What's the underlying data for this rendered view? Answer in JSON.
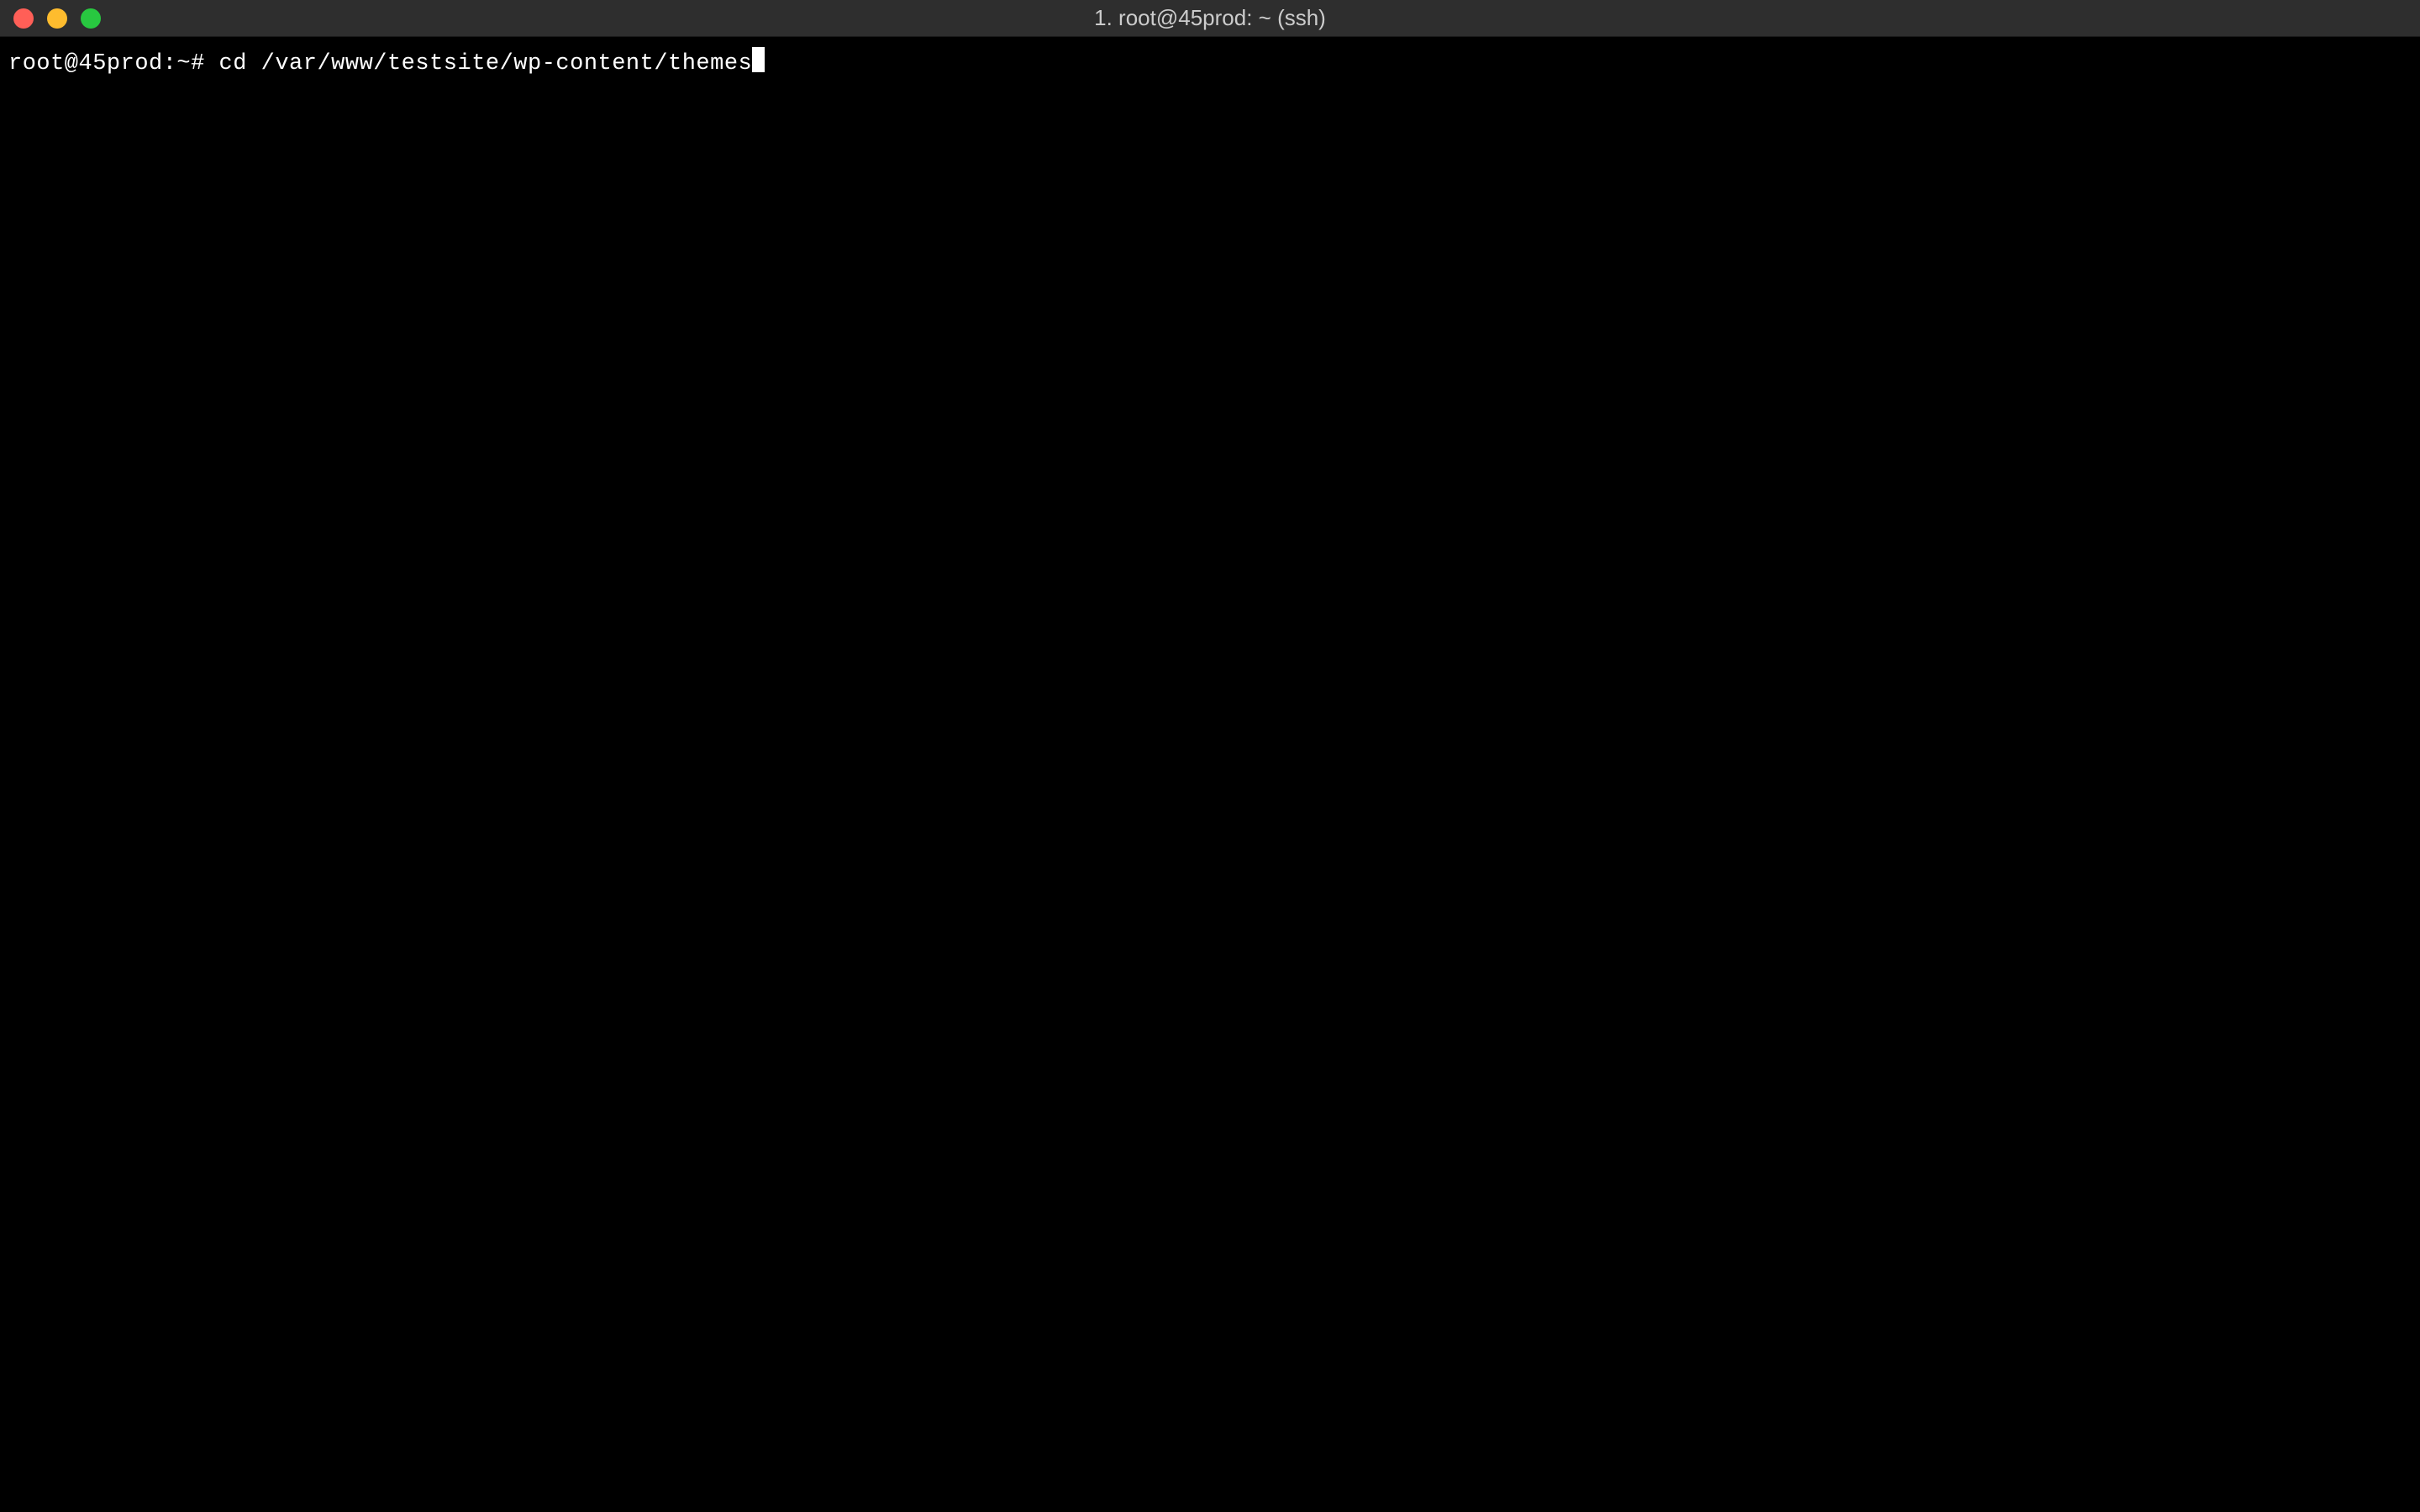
{
  "titlebar": {
    "title": "1. root@45prod: ~ (ssh)"
  },
  "terminal": {
    "prompt": "root@45prod:~#",
    "command": "cd /var/www/testsite/wp-content/themes"
  }
}
